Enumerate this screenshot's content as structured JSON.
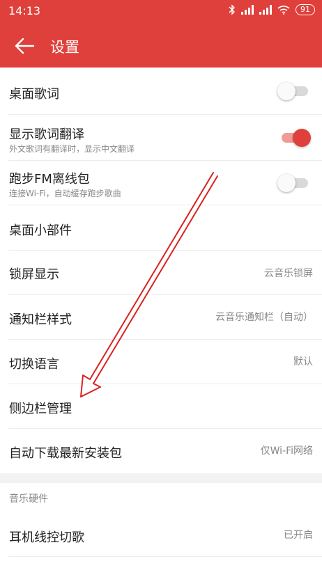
{
  "status_bar": {
    "time": "14:13",
    "battery": "91"
  },
  "app_bar": {
    "back_icon": "arrow-left-icon",
    "title": "设置"
  },
  "settings": [
    {
      "label": "桌面歌词",
      "subtitle": "",
      "value": "",
      "toggle": "off"
    },
    {
      "label": "显示歌词翻译",
      "subtitle": "外文歌词有翻译时，显示中文翻译",
      "value": "",
      "toggle": "on"
    },
    {
      "label": "跑步FM离线包",
      "subtitle": "连接Wi-Fi，自动缓存跑步歌曲",
      "value": "",
      "toggle": "off"
    },
    {
      "label": "桌面小部件",
      "subtitle": "",
      "value": ""
    },
    {
      "label": "锁屏显示",
      "subtitle": "",
      "value": "云音乐锁屏"
    },
    {
      "label": "通知栏样式",
      "subtitle": "",
      "value": "云音乐通知栏（自动）"
    },
    {
      "label": "切换语言",
      "subtitle": "",
      "value": "默认"
    },
    {
      "label": "侧边栏管理",
      "subtitle": "",
      "value": ""
    },
    {
      "label": "自动下载最新安装包",
      "subtitle": "",
      "value": "仅Wi-Fi网络"
    }
  ],
  "section_header": "音乐硬件",
  "hardware": [
    {
      "label": "耳机线控切歌",
      "value": "已开启"
    }
  ],
  "colors": {
    "accent": "#e0403b",
    "annotation": "#d9231f"
  }
}
